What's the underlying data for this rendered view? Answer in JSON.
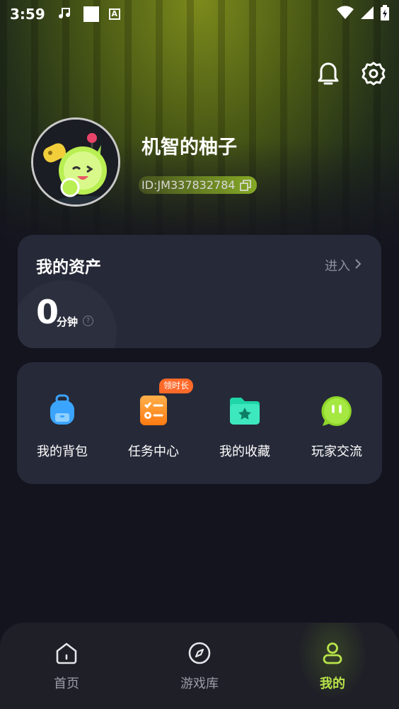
{
  "status_bar": {
    "time": "3:59",
    "a_label": "A"
  },
  "header_icons": [
    "bell-icon",
    "gear-icon"
  ],
  "profile": {
    "username": "机智的柚子",
    "id_text": "ID:JM337832784"
  },
  "assets": {
    "title": "我的资产",
    "enter_label": "进入",
    "value": "0",
    "unit": "分钟",
    "help": "?"
  },
  "features": {
    "badge": "领时长",
    "items": [
      {
        "label": "我的背包",
        "icon": "backpack-icon",
        "color": "#3ba4ff"
      },
      {
        "label": "任务中心",
        "icon": "task-icon",
        "color": "#ff8a1f"
      },
      {
        "label": "我的收藏",
        "icon": "favorite-folder-icon",
        "color": "#1fd6a8"
      },
      {
        "label": "玩家交流",
        "icon": "chat-icon",
        "color": "#8ed62a"
      }
    ]
  },
  "bottom_nav": {
    "items": [
      {
        "label": "首页",
        "icon": "home-icon"
      },
      {
        "label": "游戏库",
        "icon": "compass-icon"
      },
      {
        "label": "我的",
        "icon": "user-icon",
        "active": true
      }
    ]
  },
  "colors": {
    "accent": "#b8e34a",
    "card": "#262a38",
    "background": "#14141f"
  }
}
